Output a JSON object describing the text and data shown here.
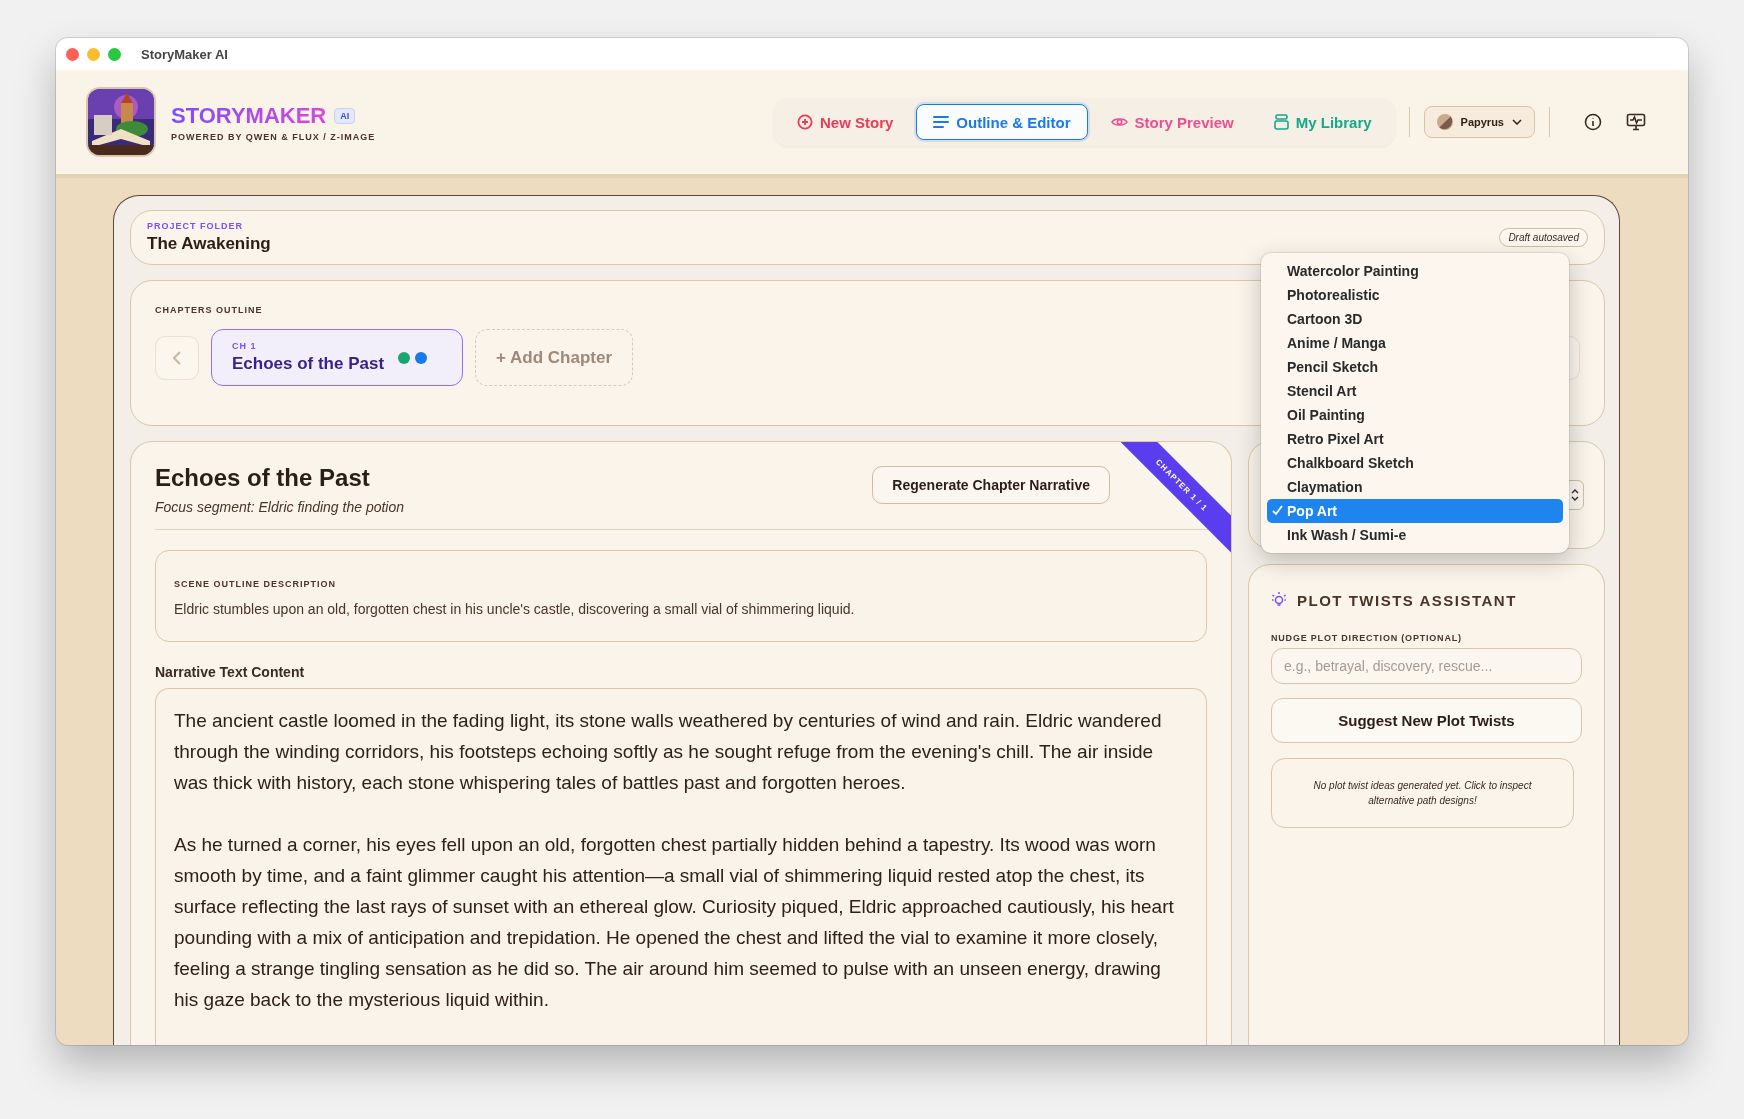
{
  "window": {
    "title": "StoryMaker AI"
  },
  "brand": {
    "name": "STORYMAKER",
    "badge": "AI",
    "tagline": "POWERED BY QWEN & FLUX / Z-IMAGE"
  },
  "nav": [
    {
      "label": "New Story",
      "kind": "plus",
      "selected": false,
      "color": "#ee3a55"
    },
    {
      "label": "Outline & Editor",
      "kind": "lines",
      "selected": true,
      "color": "#1a7ae8"
    },
    {
      "label": "Story Preview",
      "kind": "eye",
      "selected": false,
      "color": "#ee4d8f"
    },
    {
      "label": "My Library",
      "kind": "stack",
      "selected": false,
      "color": "#13a98a"
    }
  ],
  "theme_picker": {
    "label": "Papyrus"
  },
  "project": {
    "label": "PROJECT FOLDER",
    "title": "The Awakening",
    "status": "Draft autosaved"
  },
  "chapters": {
    "label": "CHAPTERS OUTLINE",
    "add_label": "+ Add Chapter",
    "items": [
      {
        "number": "CH 1",
        "title": "Echoes of the Past",
        "selected": true,
        "dots": [
          {
            "color": "#16a870"
          },
          {
            "color": "#1a7ae8"
          }
        ]
      }
    ]
  },
  "editor": {
    "title": "Echoes of the Past",
    "focus": "Focus segment: Eldric finding the potion",
    "ribbon": "CHAPTER 1 / 1",
    "button": "Regenerate Chapter Narrative",
    "scene_label": "SCENE OUTLINE DESCRIPTION",
    "scene_text": "Eldric stumbles upon an old, forgotten chest in his uncle's castle, discovering a small vial of shimmering liquid.",
    "narrative_label": "Narrative Text Content",
    "narrative": [
      "The ancient castle loomed in the fading light, its stone walls weathered by centuries of wind and rain. Eldric wandered through the winding corridors, his footsteps echoing softly as he sought refuge from the evening's chill. The air inside was thick with history, each stone whispering tales of battles past and forgotten heroes.",
      "As he turned a corner, his eyes fell upon an old, forgotten chest partially hidden behind a tapestry. Its wood was worn smooth by time, and a faint glimmer caught his attention—a small vial of shimmering liquid rested atop the chest, its surface reflecting the last rays of sunset with an ethereal glow. Curiosity piqued, Eldric approached cautiously, his heart pounding with a mix of anticipation and trepidation. He opened the chest and lifted the vial to examine it more closely, feeling a strange tingling sensation as he did so. The air around him seemed to pulse with an unseen energy, drawing his gaze back to the mysterious liquid within."
    ]
  },
  "style_dropdown": {
    "options": [
      {
        "label": "Watercolor Painting",
        "selected": false
      },
      {
        "label": "Photorealistic",
        "selected": false
      },
      {
        "label": "Cartoon 3D",
        "selected": false
      },
      {
        "label": "Anime / Manga",
        "selected": false
      },
      {
        "label": "Pencil Sketch",
        "selected": false
      },
      {
        "label": "Stencil Art",
        "selected": false
      },
      {
        "label": "Oil Painting",
        "selected": false
      },
      {
        "label": "Retro Pixel Art",
        "selected": false
      },
      {
        "label": "Chalkboard Sketch",
        "selected": false
      },
      {
        "label": "Claymation",
        "selected": false
      },
      {
        "label": "Pop Art",
        "selected": true
      },
      {
        "label": "Ink Wash / Sumi-e",
        "selected": false
      }
    ]
  },
  "plot_twists": {
    "title": "PLOT TWISTS ASSISTANT",
    "field_label": "NUDGE PLOT DIRECTION (OPTIONAL)",
    "placeholder": "e.g., betrayal, discovery, rescue...",
    "button": "Suggest New Plot Twists",
    "empty_text": "No plot twist ideas generated yet. Click to inspect alternative path designs!"
  }
}
